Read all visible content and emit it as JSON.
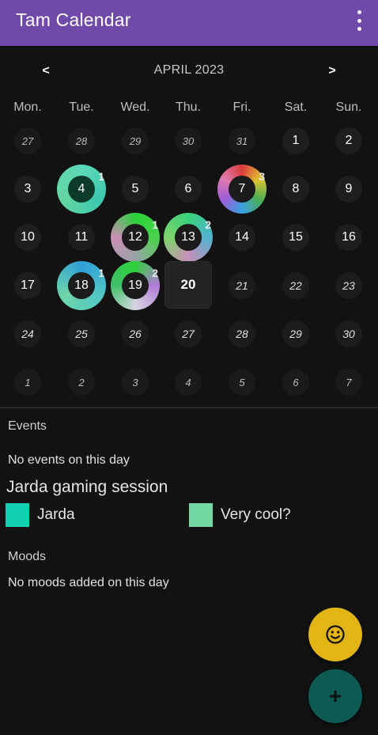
{
  "app": {
    "title": "Tam Calendar",
    "accent_color": "#7149a8",
    "menu_icon": "more-vertical-icon"
  },
  "calendar": {
    "prev_label": "<",
    "next_label": ">",
    "month_label": "APRIL 2023",
    "weekdays": [
      "Mon.",
      "Tue.",
      "Wed.",
      "Thu.",
      "Fri.",
      "Sat.",
      "Sun."
    ],
    "weeks": [
      [
        {
          "label": "27",
          "other": true
        },
        {
          "label": "28",
          "other": true
        },
        {
          "label": "29",
          "other": true
        },
        {
          "label": "30",
          "other": true
        },
        {
          "label": "31",
          "other": true
        },
        {
          "label": "1"
        },
        {
          "label": "2"
        }
      ],
      [
        {
          "label": "3"
        },
        {
          "label": "4",
          "events": 1,
          "ring": "teal"
        },
        {
          "label": "5"
        },
        {
          "label": "6"
        },
        {
          "label": "7",
          "events": 3,
          "ring": "rainbow"
        },
        {
          "label": "8"
        },
        {
          "label": "9"
        }
      ],
      [
        {
          "label": "10"
        },
        {
          "label": "11"
        },
        {
          "label": "12",
          "events": 1,
          "ring": "green"
        },
        {
          "label": "13",
          "events": 2,
          "ring": "green-pink"
        },
        {
          "label": "14"
        },
        {
          "label": "15"
        },
        {
          "label": "16"
        }
      ],
      [
        {
          "label": "17"
        },
        {
          "label": "18",
          "events": 1,
          "ring": "teal-blue"
        },
        {
          "label": "19",
          "events": 2,
          "ring": "green-purple"
        },
        {
          "label": "20",
          "today": true
        },
        {
          "label": "21",
          "future": true
        },
        {
          "label": "22",
          "future": true
        },
        {
          "label": "23",
          "future": true
        }
      ],
      [
        {
          "label": "24",
          "future": true
        },
        {
          "label": "25",
          "future": true
        },
        {
          "label": "26",
          "future": true
        },
        {
          "label": "27",
          "future": true
        },
        {
          "label": "28",
          "future": true
        },
        {
          "label": "29",
          "future": true
        },
        {
          "label": "30",
          "future": true
        }
      ],
      [
        {
          "label": "1",
          "other": true
        },
        {
          "label": "2",
          "other": true
        },
        {
          "label": "3",
          "other": true
        },
        {
          "label": "4",
          "other": true
        },
        {
          "label": "5",
          "other": true
        },
        {
          "label": "6",
          "other": true
        },
        {
          "label": "7",
          "other": true
        }
      ]
    ]
  },
  "events": {
    "heading": "Events",
    "empty_text": "No events on this day",
    "item": {
      "title": "Jarda gaming session",
      "tags": [
        {
          "label": "Jarda",
          "color": "#13d1b0"
        },
        {
          "label": "Very cool?",
          "color": "#72d9a4"
        }
      ]
    }
  },
  "moods": {
    "heading": "Moods",
    "empty_text": "No moods added on this day"
  },
  "fabs": {
    "mood_icon": "smiley-icon",
    "mood_color": "#e2b515",
    "add_icon": "plus-icon",
    "add_label": "+",
    "add_color": "#0d5a52"
  }
}
